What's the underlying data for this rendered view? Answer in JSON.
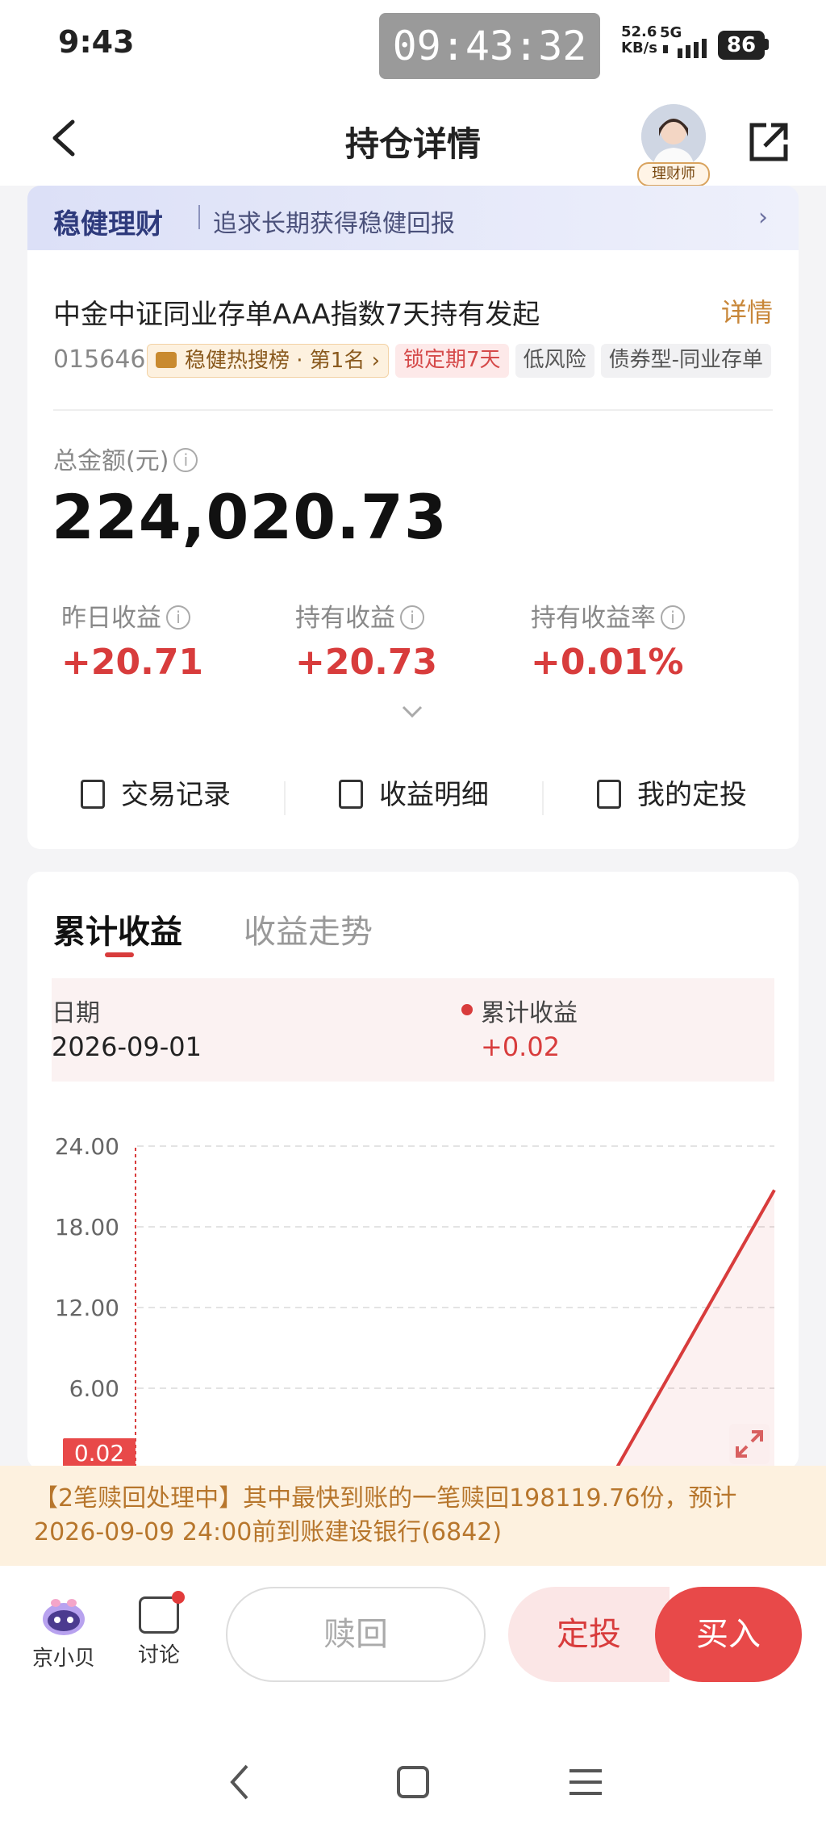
{
  "status_bar": {
    "time": "9:43",
    "clock_overlay": "09:43:32",
    "net_speed_value": "52.6",
    "net_speed_unit": "KB/s",
    "network": "5G",
    "battery": "86"
  },
  "header": {
    "title": "持仓详情",
    "advisor_label": "理财师"
  },
  "banner": {
    "title": "稳健理财",
    "text": "追求长期获得稳健回报"
  },
  "fund": {
    "name": "中金中证同业存单AAA指数7天持有发起",
    "detail_link": "详情",
    "code": "015646",
    "tags": {
      "hot": "稳健热搜榜 · 第1名",
      "lock": "锁定期7天",
      "risk": "低风险",
      "type": "债券型-同业存单"
    },
    "total_label": "总金额(元)",
    "total_value": "224,020.73",
    "metrics": {
      "yesterday_label": "昨日收益",
      "yesterday_value": "+20.71",
      "holding_label": "持有收益",
      "holding_value": "+20.73",
      "rate_label": "持有收益率",
      "rate_value": "+0.01%"
    },
    "actions": {
      "records": "交易记录",
      "income_detail": "收益明细",
      "my_sip": "我的定投"
    }
  },
  "chart_section": {
    "tabs": [
      "累计收益",
      "收益走势"
    ],
    "active_tab": "累计收益",
    "tooltip": {
      "date_label": "日期",
      "date": "2026-09-01",
      "series_label": "累计收益",
      "value": "+0.02"
    },
    "marker_label": "0.02"
  },
  "chart_data": {
    "type": "area",
    "series": [
      {
        "name": "累计收益",
        "values": [
          0.02,
          0.02,
          20.73
        ]
      }
    ],
    "x": [
      "2026-09-01",
      "",
      ""
    ],
    "y_ticks": [
      "24.00",
      "18.00",
      "12.00",
      "6.00"
    ],
    "ylim": [
      0,
      24
    ],
    "grid": true,
    "color": "#d83c3c"
  },
  "notice": {
    "text": "【2笔赎回处理中】其中最快到账的一笔赎回198119.76份，预计2026-09-09 24:00前到账建设银行(6842)"
  },
  "bottom_bar": {
    "assistant_label": "京小贝",
    "discuss_label": "讨论",
    "redeem_label": "赎回",
    "sip_label": "定投",
    "buy_label": "买入"
  },
  "colors": {
    "accent_red": "#d83c3c",
    "gold": "#c8873a",
    "banner_blue": "#2e3a7c"
  }
}
